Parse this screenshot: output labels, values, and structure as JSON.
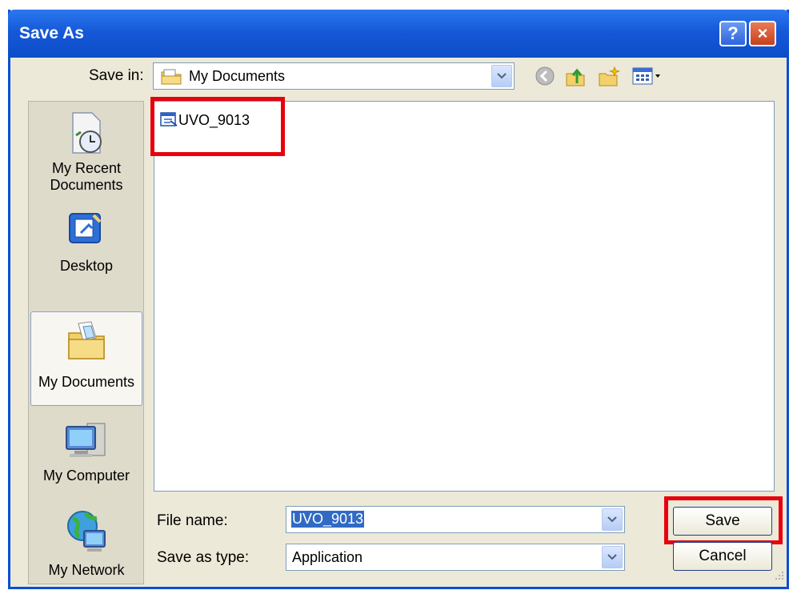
{
  "window": {
    "title": "Save As",
    "help_label": "?",
    "close_label": "×"
  },
  "save_in": {
    "label": "Save in:",
    "value": "My Documents"
  },
  "toolbar": {
    "icons": [
      "back-icon",
      "up-folder-icon",
      "new-folder-icon",
      "views-menu-icon"
    ]
  },
  "places": [
    {
      "label_line1": "My Recent",
      "label_line2": "Documents",
      "icon": "recent-documents-icon"
    },
    {
      "label_line1": "Desktop",
      "icon": "desktop-icon"
    },
    {
      "label_line1": "My Documents",
      "icon": "my-documents-icon"
    },
    {
      "label_line1": "My Computer",
      "icon": "my-computer-icon"
    },
    {
      "label_line1": "My Network",
      "icon": "my-network-icon"
    }
  ],
  "files": [
    {
      "name": "UVO_9013",
      "icon": "application-file-icon"
    }
  ],
  "file_name": {
    "label": "File name:",
    "value": "UVO_9013"
  },
  "save_as_type": {
    "label": "Save as type:",
    "value": "Application"
  },
  "buttons": {
    "save": "Save",
    "cancel": "Cancel"
  },
  "colors": {
    "titlebar": "#0b4cc8",
    "highlight_box": "#e8000a",
    "dialog_bg": "#ece9d8",
    "selection": "#316ac5"
  }
}
